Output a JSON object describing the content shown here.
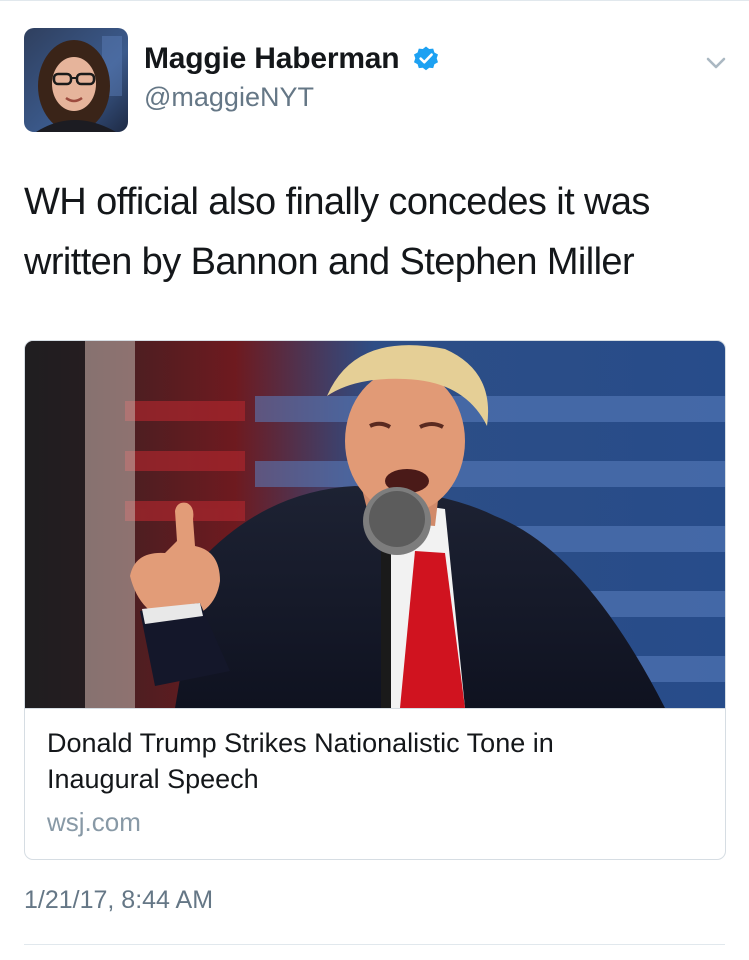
{
  "author": {
    "display_name": "Maggie Haberman",
    "handle": "@maggieNYT",
    "verified": true,
    "avatar_icon": "profile-photo"
  },
  "tweet": {
    "text_lines": [
      "WH official also finally concedes it was",
      "written by Bannon and Stephen Miller"
    ],
    "timestamp": "1/21/17, 8:44 AM"
  },
  "card": {
    "image_icon": "news-photo",
    "title_lines": [
      "Donald Trump Strikes Nationalistic Tone in",
      "Inaugural Speech"
    ],
    "domain": "wsj.com"
  },
  "colors": {
    "verified_blue": "#1da1f2",
    "secondary_text": "#657786",
    "border": "#d6dde3"
  }
}
